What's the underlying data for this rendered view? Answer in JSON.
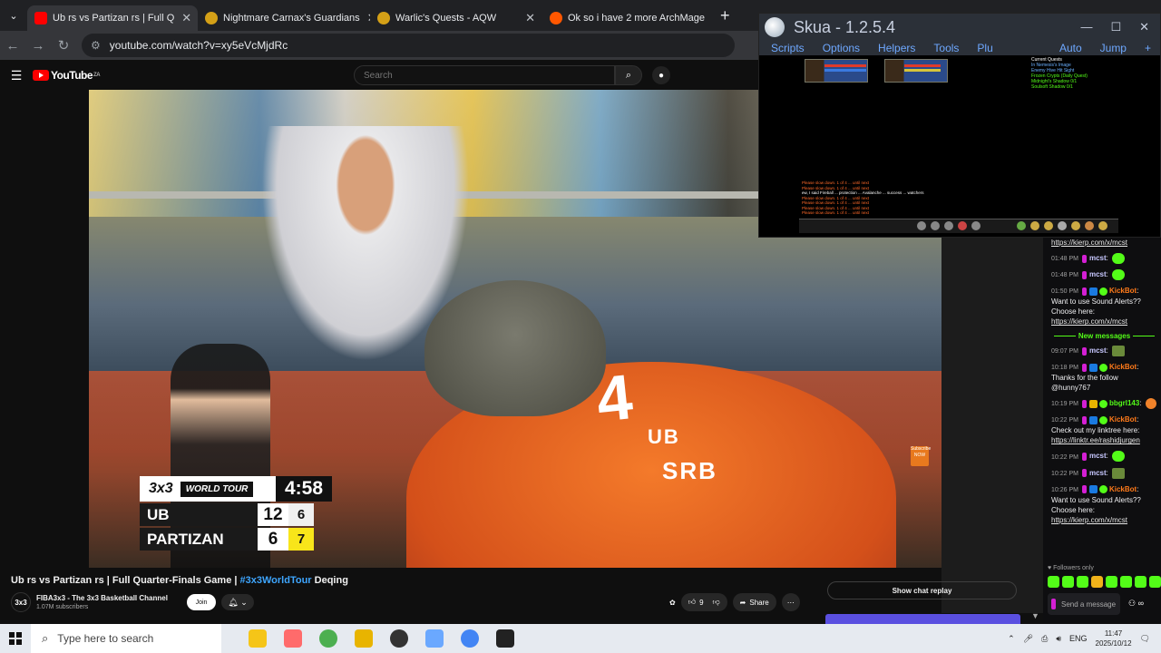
{
  "browser": {
    "tabs": [
      {
        "title": "Ub rs vs Partizan rs | Full Q",
        "active": true,
        "favicon_color": "#ff0000"
      },
      {
        "title": "Nightmare Carnax's Guardians",
        "active": false,
        "favicon_color": "#d4a017"
      },
      {
        "title": "Warlic's Quests - AQW",
        "active": false,
        "favicon_color": "#d4a017"
      },
      {
        "title": "Ok so i have 2 more ArchMage",
        "active": false,
        "favicon_color": "#ff5700"
      }
    ],
    "url": "youtube.com/watch?v=xy5eVcMjdRc",
    "new_tab": "+"
  },
  "youtube": {
    "logo_text": "YouTube",
    "region": "ZA",
    "search_placeholder": "Search",
    "video_title_main": "Ub rs vs Partizan rs | Full Quarter-Finals Game | ",
    "video_title_tag": "#3x3WorldTour",
    "video_title_end": " Deqing",
    "channel_name": "FIBA3x3 - The 3x3 Basketball Channel",
    "channel_subs": "1.07M subscribers",
    "channel_avatar": "3x3",
    "join_label": "Join",
    "like_count": "9",
    "share_label": "Share",
    "show_chat_replay": "Show chat replay"
  },
  "scoreboard": {
    "brand": "3x3",
    "tour": "WORLD TOUR",
    "clock": "4:58",
    "teams": [
      {
        "name": "UB",
        "score": "12",
        "fouls": "6",
        "highlight": false
      },
      {
        "name": "PARTIZAN",
        "score": "6",
        "fouls": "7",
        "highlight": true
      }
    ]
  },
  "video_overlay": {
    "jersey_line1": "UB",
    "jersey_line2": "SRB",
    "jersey_number": "4",
    "subscribe_badge": "Subscribe NOW"
  },
  "skua": {
    "title": "Skua - 1.2.5.4",
    "menu": [
      "Scripts",
      "Options",
      "Helpers",
      "Tools",
      "Plu"
    ],
    "menu_right": [
      "Auto",
      "Jump",
      "+"
    ],
    "quest_lines": [
      "Current Quests",
      "In Nemesis's Image",
      "Enemy Hive Hit Sight",
      "Frozen Crypts (Daily Quest)",
      "Midnight's Shadow 0/1",
      "Soulsoft Shadow 0/1"
    ],
    "log_lines": [
      "Please slow down. 1 of 4 ... until next",
      "Please slow down. 1 of 4 ... until next",
      "ew, I said Fireball ... protection ... Avalanche ... success ... watchers",
      "Please slow down. 1 of 4 ... until next",
      "Please slow down. 1 of 4 ... until next",
      "Please slow down. 1 of 4 ... until next",
      "Please slow down. 1 of 4 ... until next"
    ]
  },
  "chat": {
    "top_link": "https://kierp.com/x/mcst",
    "messages": [
      {
        "time": "01:48 PM",
        "user": "mcst",
        "class": "mcst",
        "text": "",
        "emote": "green"
      },
      {
        "time": "01:48 PM",
        "user": "mcst",
        "class": "mcst",
        "text": "",
        "emote": "green"
      },
      {
        "time": "01:50 PM",
        "user": "KickBot",
        "class": "kick",
        "text": "Want to use Sound Alerts?? Choose here:",
        "link": "https://kierp.com/x/mcst"
      }
    ],
    "new_messages_label": "New messages",
    "messages_after": [
      {
        "time": "09:07 PM",
        "user": "mcst",
        "class": "mcst",
        "text": "",
        "emote": "face"
      },
      {
        "time": "10:18 PM",
        "user": "KickBot",
        "class": "kick",
        "text": "Thanks for the follow @hunny767"
      },
      {
        "time": "10:19 PM",
        "user": "bbgrl143",
        "class": "bb",
        "text": "",
        "emote": "heart"
      },
      {
        "time": "10:22 PM",
        "user": "KickBot",
        "class": "kick",
        "text": "Check out my linktree here:",
        "link": "https://linktr.ee/rashidjurgen"
      },
      {
        "time": "10:22 PM",
        "user": "mcst",
        "class": "mcst",
        "text": "",
        "emote": "green"
      },
      {
        "time": "10:22 PM",
        "user": "mcst",
        "class": "mcst",
        "text": "",
        "emote": "face"
      },
      {
        "time": "10:26 PM",
        "user": "KickBot",
        "class": "kick",
        "text": "Want to use Sound Alerts?? Choose here:",
        "link": "https://kierp.com/x/mcst"
      }
    ],
    "followers_only": "Followers only",
    "send_placeholder": "Send a message"
  },
  "taskbar": {
    "search_placeholder": "Type here to search",
    "language": "ENG",
    "time": "11:47",
    "date": "2025/10/12",
    "app_colors": [
      "#f5c518",
      "#ff6b6b",
      "#4caf50",
      "#e8b400",
      "#333",
      "#6aa8ff",
      "#4285f4",
      "#222"
    ]
  }
}
